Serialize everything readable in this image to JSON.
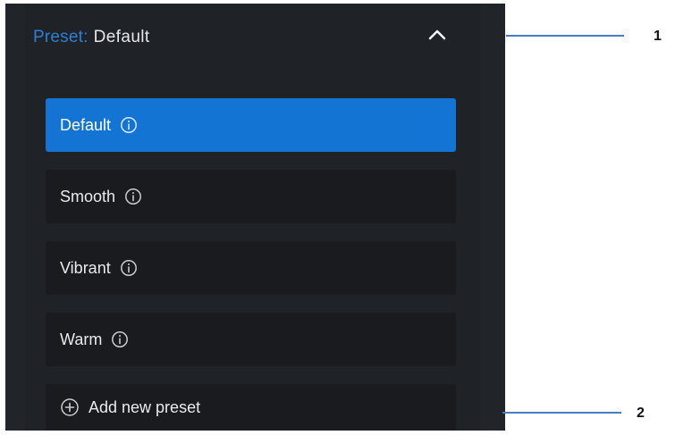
{
  "preset_header": {
    "label": "Preset:",
    "value": "Default"
  },
  "presets": [
    {
      "label": "Default",
      "selected": true
    },
    {
      "label": "Smooth",
      "selected": false
    },
    {
      "label": "Vibrant",
      "selected": false
    },
    {
      "label": "Warm",
      "selected": false
    }
  ],
  "add_preset": {
    "label": "Add new preset"
  },
  "callouts": {
    "one": "1",
    "two": "2"
  },
  "colors": {
    "panel_bg": "#212429",
    "item_bg": "#191b1e",
    "selected_bg": "#1474d4",
    "accent_label": "#2f7fd2",
    "leader_line": "#4a7cc4"
  },
  "icons": {
    "collapse": "chevron-up-icon",
    "info": "info-icon",
    "add": "plus-circle-icon"
  }
}
